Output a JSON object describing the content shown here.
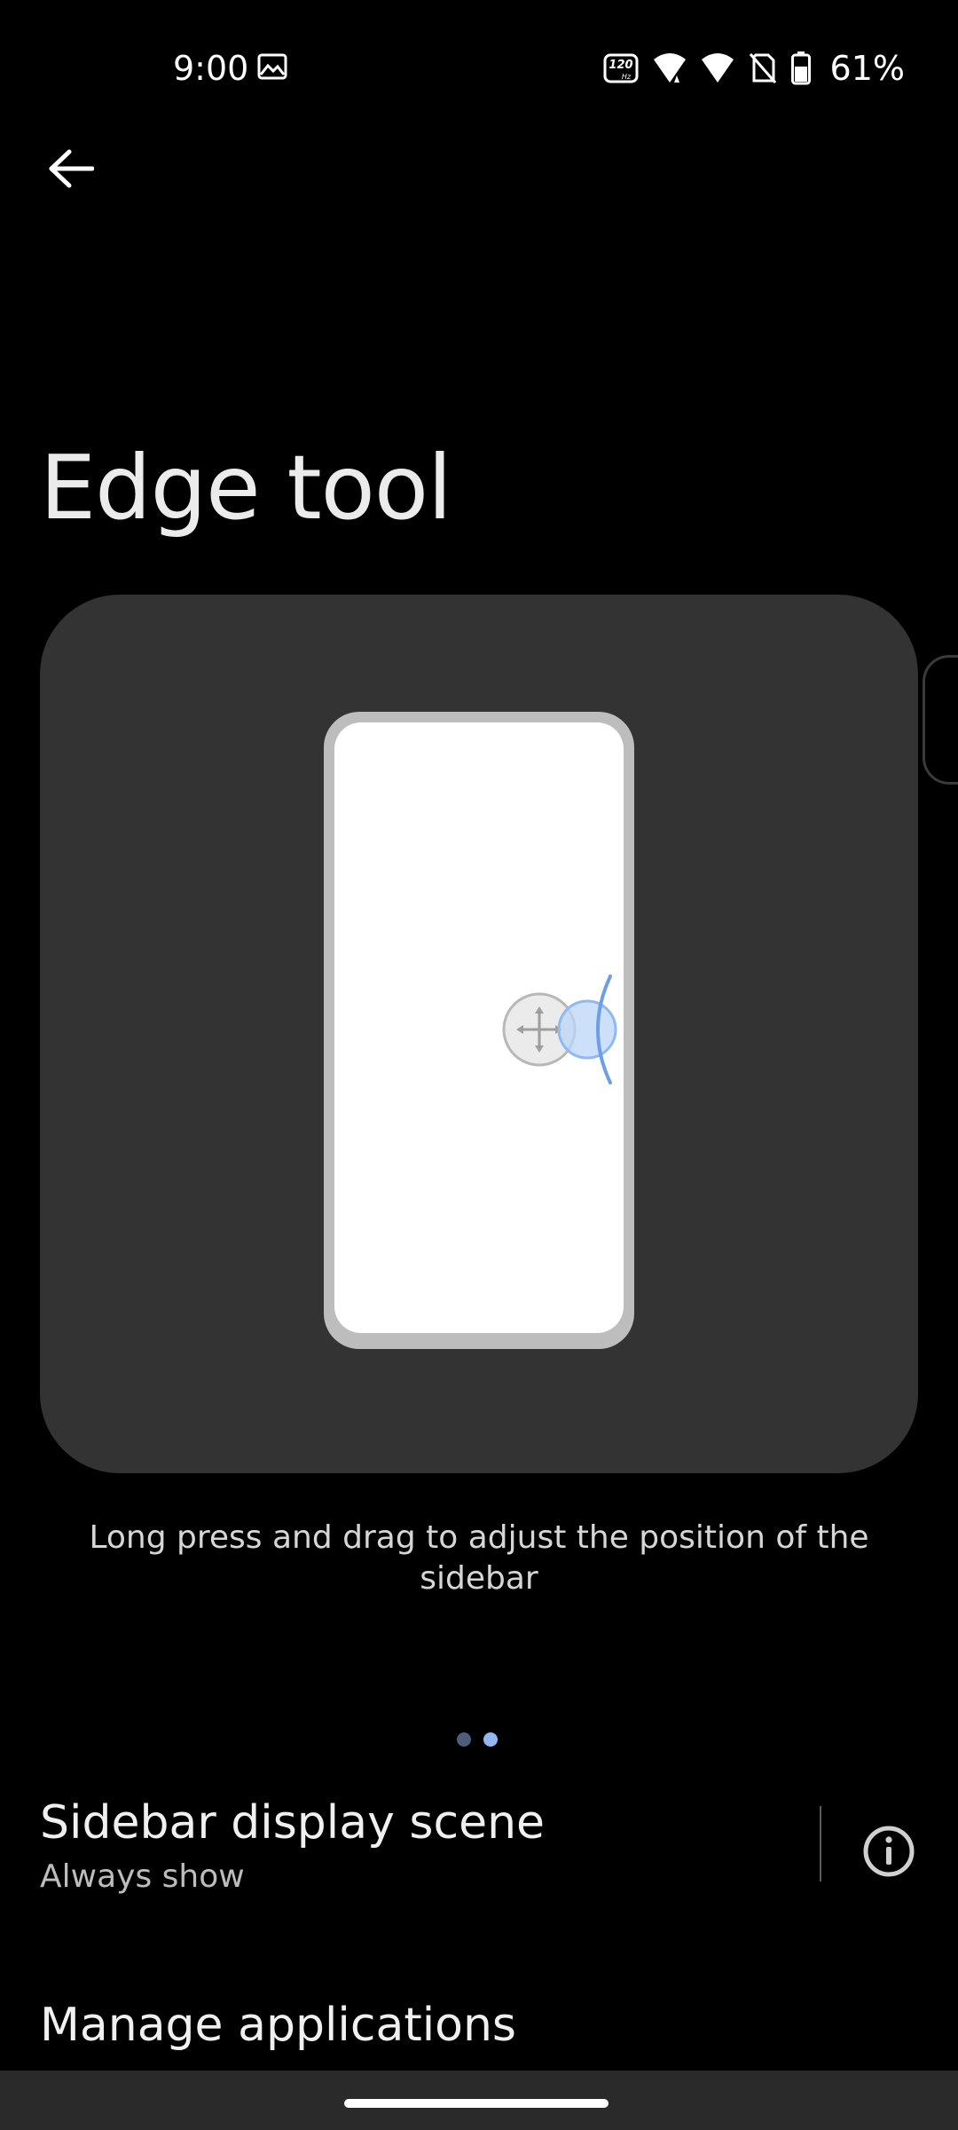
{
  "status_bar": {
    "time": "9:00",
    "refresh_rate": "120",
    "refresh_unit": "Hz",
    "battery": "61%",
    "battery_level": 0.61
  },
  "page": {
    "title": "Edge tool"
  },
  "preview": {
    "caption": "Long press and drag to adjust the position of the sidebar",
    "page_indicator": {
      "count": 2,
      "active_index": 1
    }
  },
  "settings": {
    "sidebar_display_scene": {
      "title": "Sidebar display scene",
      "value": "Always show"
    },
    "manage_applications": {
      "title": "Manage applications"
    }
  },
  "colors": {
    "background": "#000000",
    "card": "#333333",
    "accent": "#8fb8f5",
    "text_primary": "#f0f0f0",
    "text_secondary": "#bdbdbd"
  },
  "icons": [
    "gallery-icon",
    "refresh-rate-icon",
    "wifi-icon",
    "signal-icon",
    "no-sim-icon",
    "battery-icon",
    "back-arrow-icon",
    "move-icon",
    "info-icon"
  ]
}
